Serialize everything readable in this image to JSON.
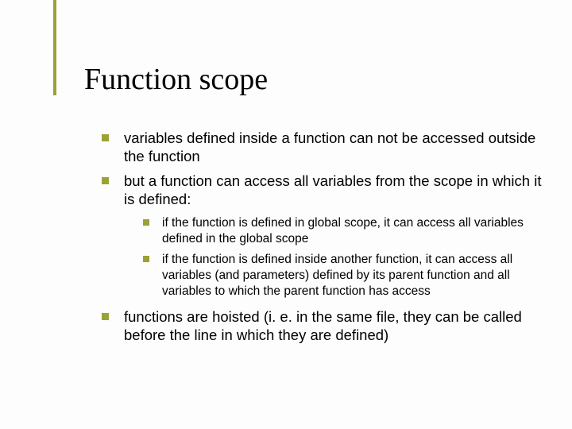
{
  "title": "Function scope",
  "bullets": {
    "b1": "variables defined inside a function can not be accessed outside the function",
    "b2": "but a function can access all variables from the scope in which it is defined:",
    "b2_sub": {
      "s1": "if the function is defined in global scope, it can access all variables defined in the global scope",
      "s2": "if the function is defined inside another function, it can access all variables (and parameters) defined by its parent function and all variables to which the parent function has access"
    },
    "b3": "functions are hoisted (i. e. in the same file, they can be called before the line in which they are defined)"
  }
}
